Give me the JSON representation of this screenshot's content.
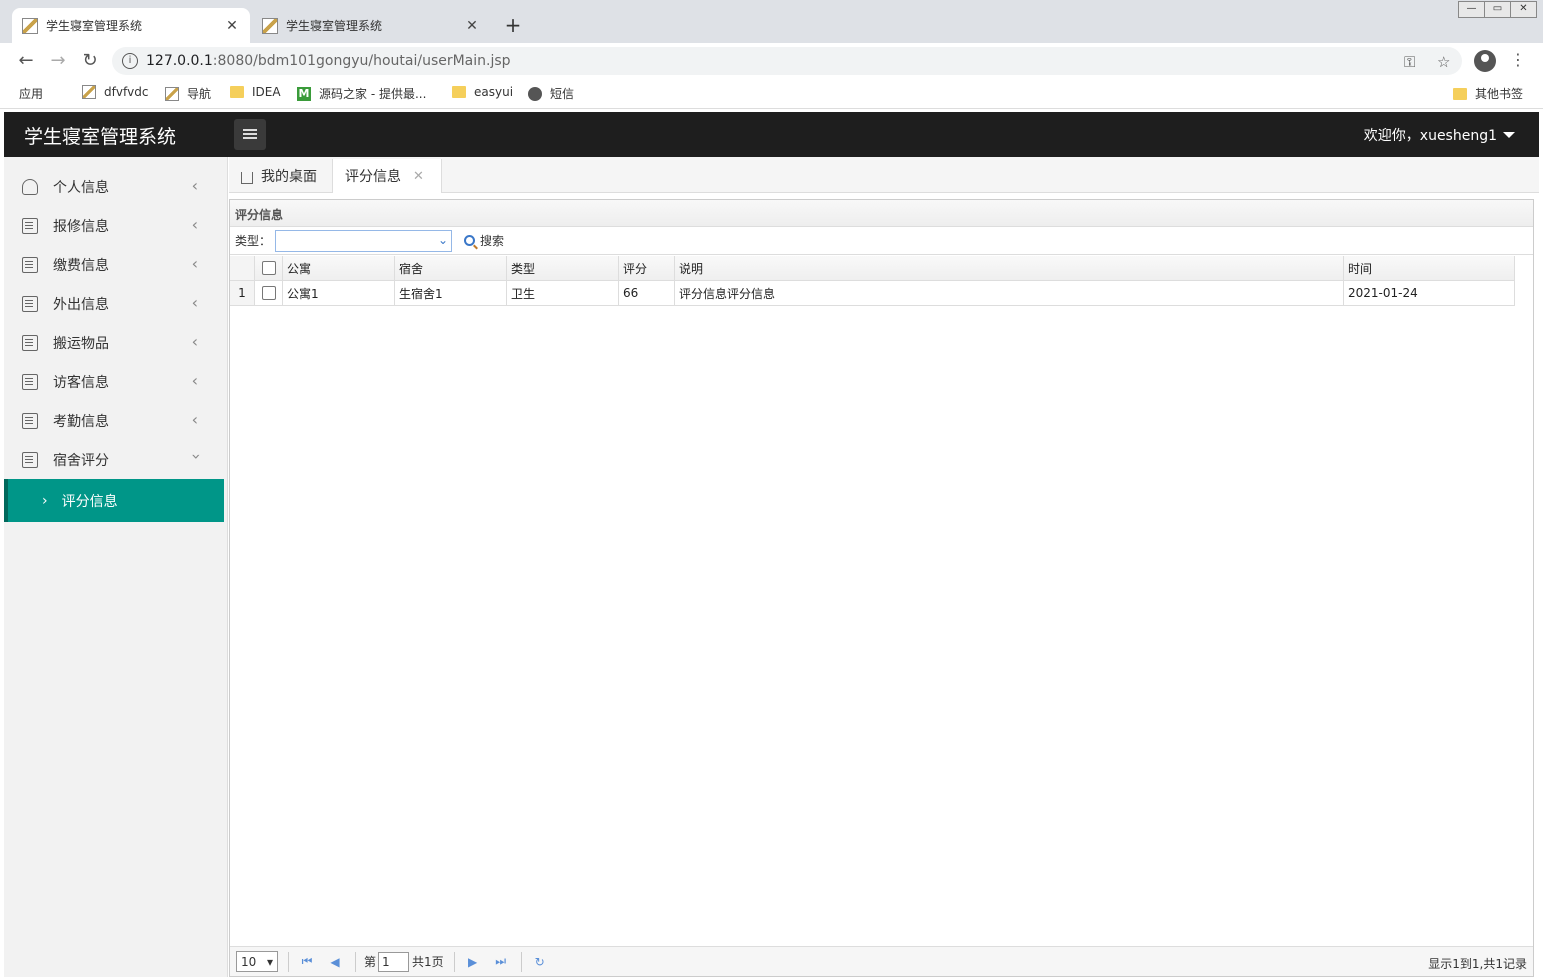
{
  "browser": {
    "tabs": [
      {
        "title": "学生寝室管理系统",
        "active": true
      },
      {
        "title": "学生寝室管理系统",
        "active": false
      }
    ],
    "new_tab": "+",
    "url_host": "127.0.0.1",
    "url_rest": ":8080/bdm101gongyu/houtai/userMain.jsp",
    "bookmarks": [
      "应用",
      "dfvfvdc",
      "导航",
      "IDEA",
      "源码之家 - 提供最...",
      "easyui",
      "短信"
    ],
    "other_bookmarks": "其他书签"
  },
  "app": {
    "title": "学生寝室管理系统",
    "welcome": "欢迎你，xuesheng1"
  },
  "sidebar": {
    "items": [
      {
        "label": "个人信息",
        "icon": "user-icon"
      },
      {
        "label": "报修信息",
        "icon": "doc-icon"
      },
      {
        "label": "缴费信息",
        "icon": "doc-icon"
      },
      {
        "label": "外出信息",
        "icon": "doc-icon"
      },
      {
        "label": "搬运物品",
        "icon": "doc-icon"
      },
      {
        "label": "访客信息",
        "icon": "doc-icon"
      },
      {
        "label": "考勤信息",
        "icon": "doc-icon"
      },
      {
        "label": "宿舍评分",
        "icon": "doc-icon",
        "expanded": true
      }
    ],
    "sub_item": "评分信息"
  },
  "page_tabs": {
    "home": "我的桌面",
    "active": "评分信息"
  },
  "panel": {
    "title": "评分信息",
    "search_label": "类型：",
    "search_button": "搜索"
  },
  "table": {
    "headers": [
      "公寓",
      "宿舍",
      "类型",
      "评分",
      "说明",
      "时间"
    ],
    "rows": [
      {
        "rownum": "1",
        "cells": [
          "公寓1",
          "生宿舍1",
          "卫生",
          "66",
          "评分信息评分信息",
          "2021-01-24"
        ]
      }
    ]
  },
  "pager": {
    "page_size": "10",
    "page_prefix": "第",
    "page_value": "1",
    "page_suffix": "共1页",
    "info": "显示1到1,共1记录"
  }
}
